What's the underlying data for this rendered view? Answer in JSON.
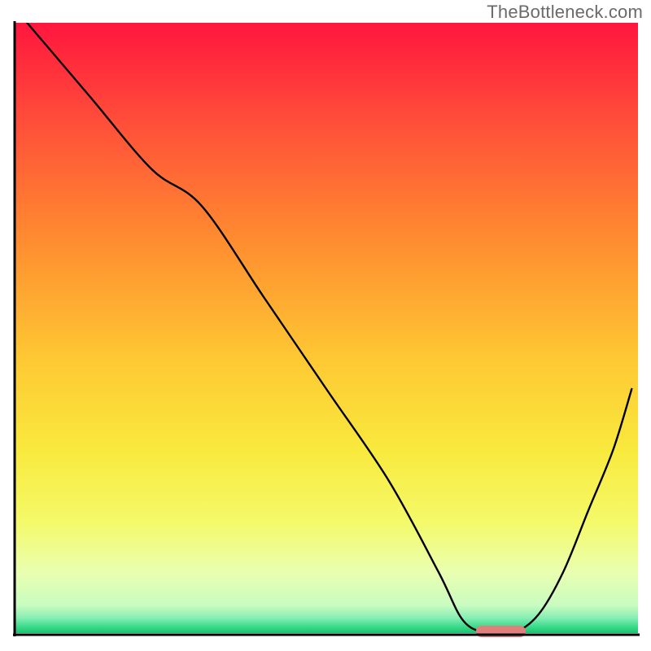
{
  "watermark": "TheBottleneck.com",
  "chart_data": {
    "type": "line",
    "title": "",
    "xlabel": "",
    "ylabel": "",
    "xlim": [
      0,
      100
    ],
    "ylim": [
      0,
      100
    ],
    "x": [
      2,
      12,
      22,
      30,
      40,
      50,
      60,
      68,
      72,
      76,
      80,
      84,
      88,
      92,
      96,
      99
    ],
    "values": [
      100,
      88,
      76,
      70,
      55,
      40,
      25,
      10,
      2,
      0,
      0,
      3,
      10,
      20,
      30,
      40
    ],
    "marker": {
      "x_center": 78,
      "y": 0,
      "width": 8,
      "height": 2,
      "color": "#e17f7f"
    },
    "gradient_stops": [
      {
        "offset": 0.0,
        "color": "#ff163e"
      },
      {
        "offset": 0.15,
        "color": "#ff4a3a"
      },
      {
        "offset": 0.35,
        "color": "#ff8a30"
      },
      {
        "offset": 0.55,
        "color": "#fec833"
      },
      {
        "offset": 0.7,
        "color": "#f9e93d"
      },
      {
        "offset": 0.82,
        "color": "#f4fa6a"
      },
      {
        "offset": 0.9,
        "color": "#eaffb0"
      },
      {
        "offset": 0.955,
        "color": "#c8fcc0"
      },
      {
        "offset": 0.975,
        "color": "#87eeb3"
      },
      {
        "offset": 0.99,
        "color": "#39d98a"
      },
      {
        "offset": 1.0,
        "color": "#1cc26f"
      }
    ],
    "axis_color": "#000000"
  }
}
